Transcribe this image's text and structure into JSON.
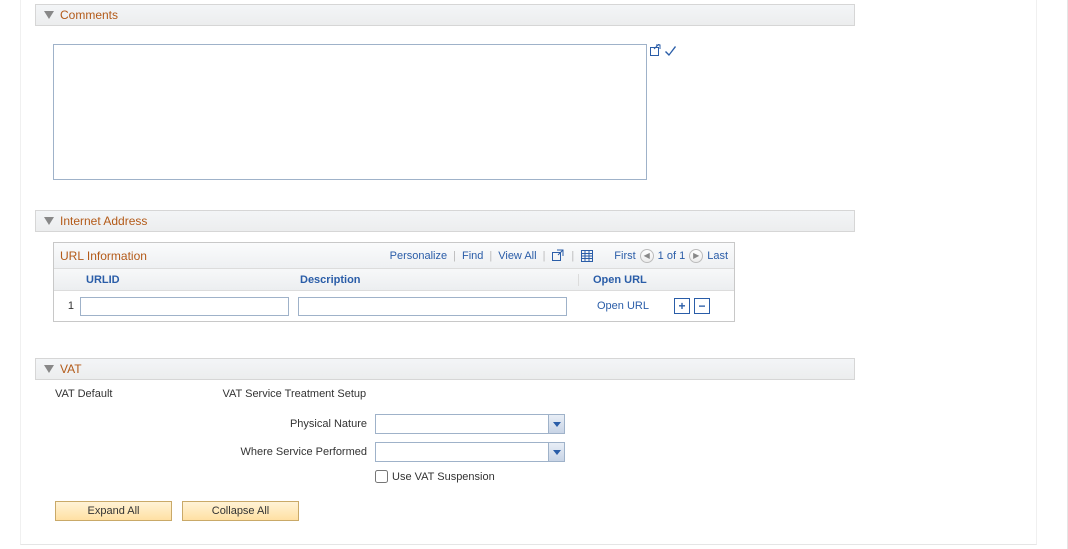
{
  "sections": {
    "comments": {
      "title": "Comments",
      "value": ""
    },
    "internet_address": {
      "title": "Internet Address"
    },
    "vat": {
      "title": "VAT"
    }
  },
  "url_grid": {
    "caption": "URL Information",
    "links": {
      "personalize": "Personalize",
      "find": "Find",
      "view_all": "View All"
    },
    "nav": {
      "first": "First",
      "count": "1 of 1",
      "last": "Last"
    },
    "headers": {
      "urlid": "URLID",
      "description": "Description",
      "open_url": "Open URL"
    },
    "rows": [
      {
        "num": "1",
        "urlid": "",
        "description": "",
        "open_url_label": "Open URL"
      }
    ]
  },
  "vat_section": {
    "default_link": "VAT Default",
    "treatment_link": "VAT Service Treatment Setup",
    "physical_nature_label": "Physical Nature",
    "physical_nature_value": "",
    "where_service_label": "Where Service Performed",
    "where_service_value": "",
    "use_suspension_label": "Use VAT Suspension",
    "use_suspension_checked": false
  },
  "buttons": {
    "expand_all": "Expand All",
    "collapse_all": "Collapse All"
  }
}
